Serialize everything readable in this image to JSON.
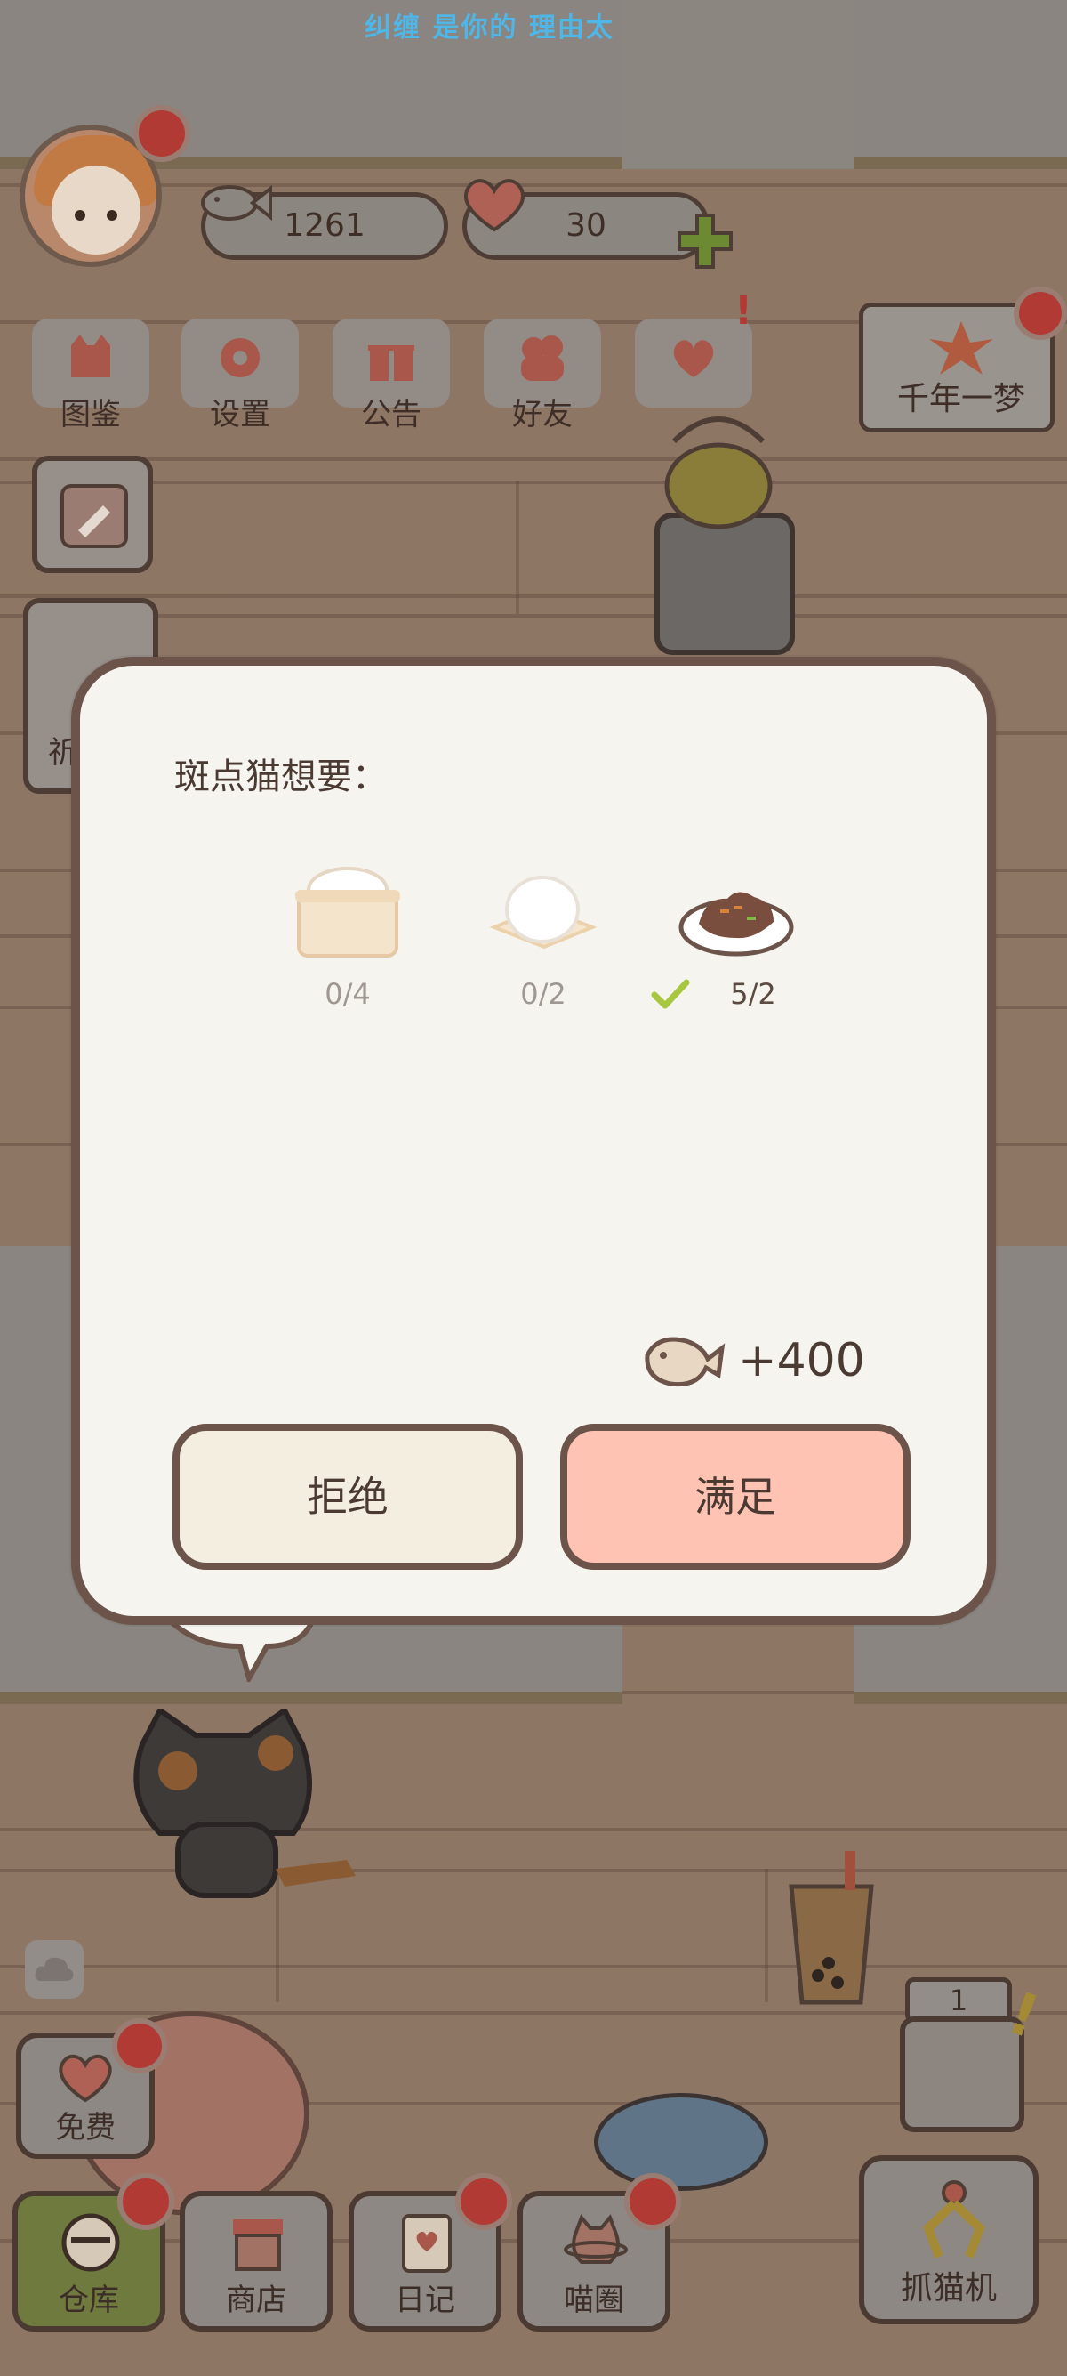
{
  "top_lyric": "纠缠 是你的 理由太",
  "currency": {
    "fish": "1261",
    "hearts": "30"
  },
  "menu": [
    {
      "label": "图鉴",
      "icon": "cat-book-icon"
    },
    {
      "label": "设置",
      "icon": "gear-icon"
    },
    {
      "label": "公告",
      "icon": "gift-icon"
    },
    {
      "label": "好友",
      "icon": "friends-icon"
    },
    {
      "label": "",
      "icon": "hearts-icon"
    }
  ],
  "event_card": {
    "label": "千年一梦"
  },
  "left_partial_label": "祈",
  "dialog": {
    "title": "斑点猫想要：",
    "wishes": [
      {
        "icon": "steamer-bun-icon",
        "count": "0/4",
        "done": false
      },
      {
        "icon": "rice-ball-icon",
        "count": "0/2",
        "done": false
      },
      {
        "icon": "curry-plate-icon",
        "count": "5/2",
        "done": true
      }
    ],
    "reward": "+400",
    "reject_label": "拒绝",
    "accept_label": "满足"
  },
  "counter": "1",
  "free_label": "免费",
  "bottom_nav": [
    {
      "label": "仓库",
      "active": true
    },
    {
      "label": "商店",
      "active": false
    },
    {
      "label": "日记",
      "active": false
    },
    {
      "label": "喵圈",
      "active": false
    }
  ],
  "claw_label": "抓猫机",
  "colors": {
    "dialog_bg": "#f5f4ef",
    "dialog_border": "#6c544a",
    "accept_bg": "#ffc3b3",
    "reject_bg": "#f4eee0",
    "badge_red": "#b23a35",
    "check_green": "#a7c73f"
  }
}
